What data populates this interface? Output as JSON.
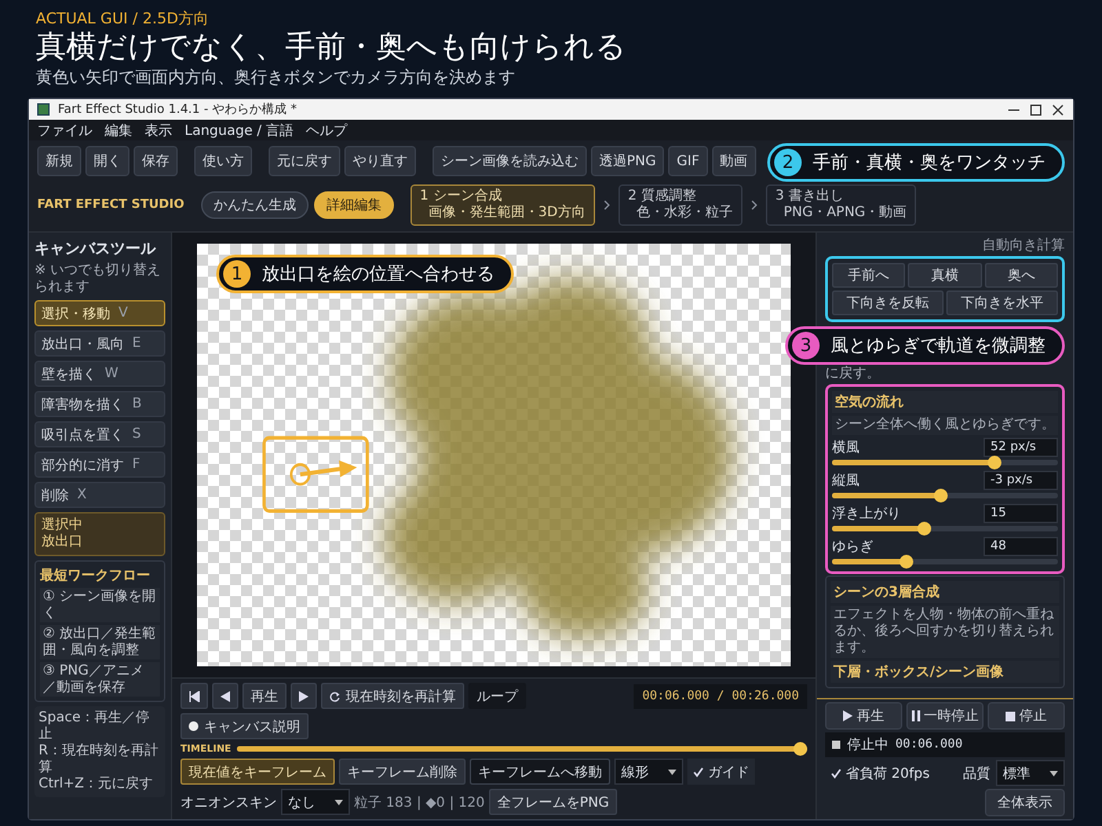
{
  "slide": {
    "kicker": "ACTUAL GUI / 2.5D方向",
    "title": "真横だけでなく、手前・奥へも向けられる",
    "subtitle": "黄色い矢印で画面内方向、奥行きボタンでカメラ方向を決めます"
  },
  "window": {
    "title": "Fart Effect Studio 1.4.1 - やわらか構成 *"
  },
  "menu": [
    "ファイル",
    "編集",
    "表示",
    "Language / 言語",
    "ヘルプ"
  ],
  "toolbar": [
    [
      "新規",
      "開く",
      "保存"
    ],
    [
      "使い方"
    ],
    [
      "元に戻す",
      "やり直す"
    ],
    [
      "シーン画像を読み込む",
      "透過PNG",
      "GIF",
      "動画"
    ]
  ],
  "header": {
    "brand": "FART EFFECT STUDIO",
    "modes": [
      {
        "label": "かんたん生成",
        "selected": false
      },
      {
        "label": "詳細編集",
        "selected": true
      }
    ],
    "steps": [
      {
        "title": "1 シーン合成",
        "detail": "画像・発生範囲・3D方向",
        "selected": true
      },
      {
        "title": "2 質感調整",
        "detail": "色・水彩・粒子",
        "selected": false
      },
      {
        "title": "3 書き出し",
        "detail": "PNG・APNG・動画",
        "selected": false
      }
    ]
  },
  "tool_panel": {
    "title": "キャンバスツール",
    "note": "※ いつでも切り替えられます",
    "tools": [
      {
        "label": "選択・移動",
        "key": "V",
        "selected": true
      },
      {
        "label": "放出口・風向",
        "key": "E",
        "selected": false
      },
      {
        "label": "壁を描く",
        "key": "W",
        "selected": false
      },
      {
        "label": "障害物を描く",
        "key": "B",
        "selected": false
      },
      {
        "label": "吸引点を置く",
        "key": "S",
        "selected": false
      },
      {
        "label": "部分的に消す",
        "key": "F",
        "selected": false
      },
      {
        "label": "削除",
        "key": "X",
        "selected": false
      }
    ],
    "selection": {
      "label": "選択中",
      "value": "放出口"
    },
    "workflow": {
      "title": "最短ワークフロー",
      "steps": [
        "① シーン画像を開く",
        "② 放出口／発生範囲・風向を調整",
        "③ PNG／アニメ／動画を保存"
      ]
    },
    "shortcuts": [
      "Space：再生／停止",
      "R：現在時刻を再計算",
      "Ctrl+Z：元に戻す"
    ]
  },
  "transport": {
    "play": "再生",
    "recalc": "現在時刻を再計算",
    "loop": {
      "label": "ループ",
      "on": false
    },
    "time": "00:06.000 / 00:26.000",
    "canvas_note": "キャンバス説明",
    "timeline_label": "TIMELINE",
    "level": 1.0
  },
  "keyframes": {
    "add": "現在値をキーフレーム",
    "delete": "キーフレーム削除",
    "goto": "キーフレームへ移動",
    "easing": "線形",
    "guide": {
      "label": "ガイド",
      "checked": true
    },
    "onion_label": "オニオンスキン",
    "onion": "なし",
    "stats": "粒子 183 | ◆0 | 120",
    "export": "全フレームをPNG"
  },
  "inspector": {
    "auto": "自動向き計算",
    "directions": [
      "手前へ",
      "真横",
      "奥へ"
    ],
    "flip_buttons": [
      "下向きを反転",
      "下向きを水平"
    ],
    "hint": "に戻す。",
    "air": {
      "title": "空気の流れ",
      "description": "シーン全体へ働く風とゆらぎです。",
      "sliders": [
        {
          "label": "横風",
          "reading": "52 px/s",
          "level": 0.72
        },
        {
          "label": "縦風",
          "reading": "-3 px/s",
          "level": 0.48
        },
        {
          "label": "浮き上がり",
          "reading": "15",
          "level": 0.41
        },
        {
          "label": "ゆらぎ",
          "reading": "48",
          "level": 0.33
        }
      ]
    },
    "layers": {
      "title": "シーンの3層合成",
      "description": "エフェクトを人物・物体の前へ重ねるか、後ろへ回すかを切り替えられます。",
      "subheading": "下層・ボックス/シーン画像"
    }
  },
  "playback": {
    "buttons": [
      "再生",
      "一時停止",
      "停止"
    ],
    "status": "停止中",
    "time": "00:06.000",
    "eco": {
      "label": "省負荷 20fps",
      "checked": true
    },
    "quality_label": "品質",
    "quality": "標準",
    "fit": "全体表示"
  },
  "callouts": [
    {
      "number": "1",
      "text": "放出口を絵の位置へ合わせる",
      "color": "#f2b233"
    },
    {
      "number": "2",
      "text": "手前・真横・奥をワンタッチ",
      "color": "#3cc8ec"
    },
    {
      "number": "3",
      "text": "風とゆらぎで軌道を微調整",
      "color": "#e85bc0"
    }
  ]
}
